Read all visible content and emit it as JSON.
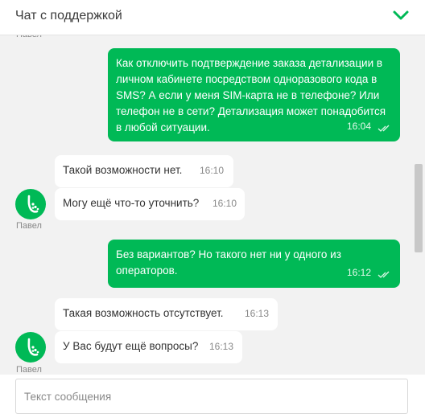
{
  "header": {
    "title": "Чат с поддержкой",
    "collapse_icon": "chevron-down-icon",
    "accent": "#00b956"
  },
  "messages": [
    {
      "direction": "out",
      "text": "Как отключить подтверждение заказа детализации в личном кабинете посредством одноразового кода в SMS? А если у меня SIM-карта не в телефоне? Или телефон не в сети? Детализация может понадобится в любой ситуации.",
      "time": "16:04",
      "status_icon": "double-check-icon"
    },
    {
      "direction": "in",
      "text": "Такой возможности нет.",
      "time": "16:10"
    },
    {
      "direction": "in",
      "text": "Могу ещё что-то уточнить?",
      "time": "16:10"
    },
    {
      "direction": "out",
      "text": "Без вариантов? Но такого нет ни у одного из операторов.",
      "time": "16:12",
      "status_icon": "double-check-icon"
    },
    {
      "direction": "in",
      "text": "Такая возможность отсутствует.",
      "time": "16:13"
    },
    {
      "direction": "in",
      "text": "У Вас будут ещё вопросы?",
      "time": "16:13"
    }
  ],
  "sender_name": "Павел",
  "composer": {
    "placeholder": "Текст сообщения",
    "value": ""
  }
}
